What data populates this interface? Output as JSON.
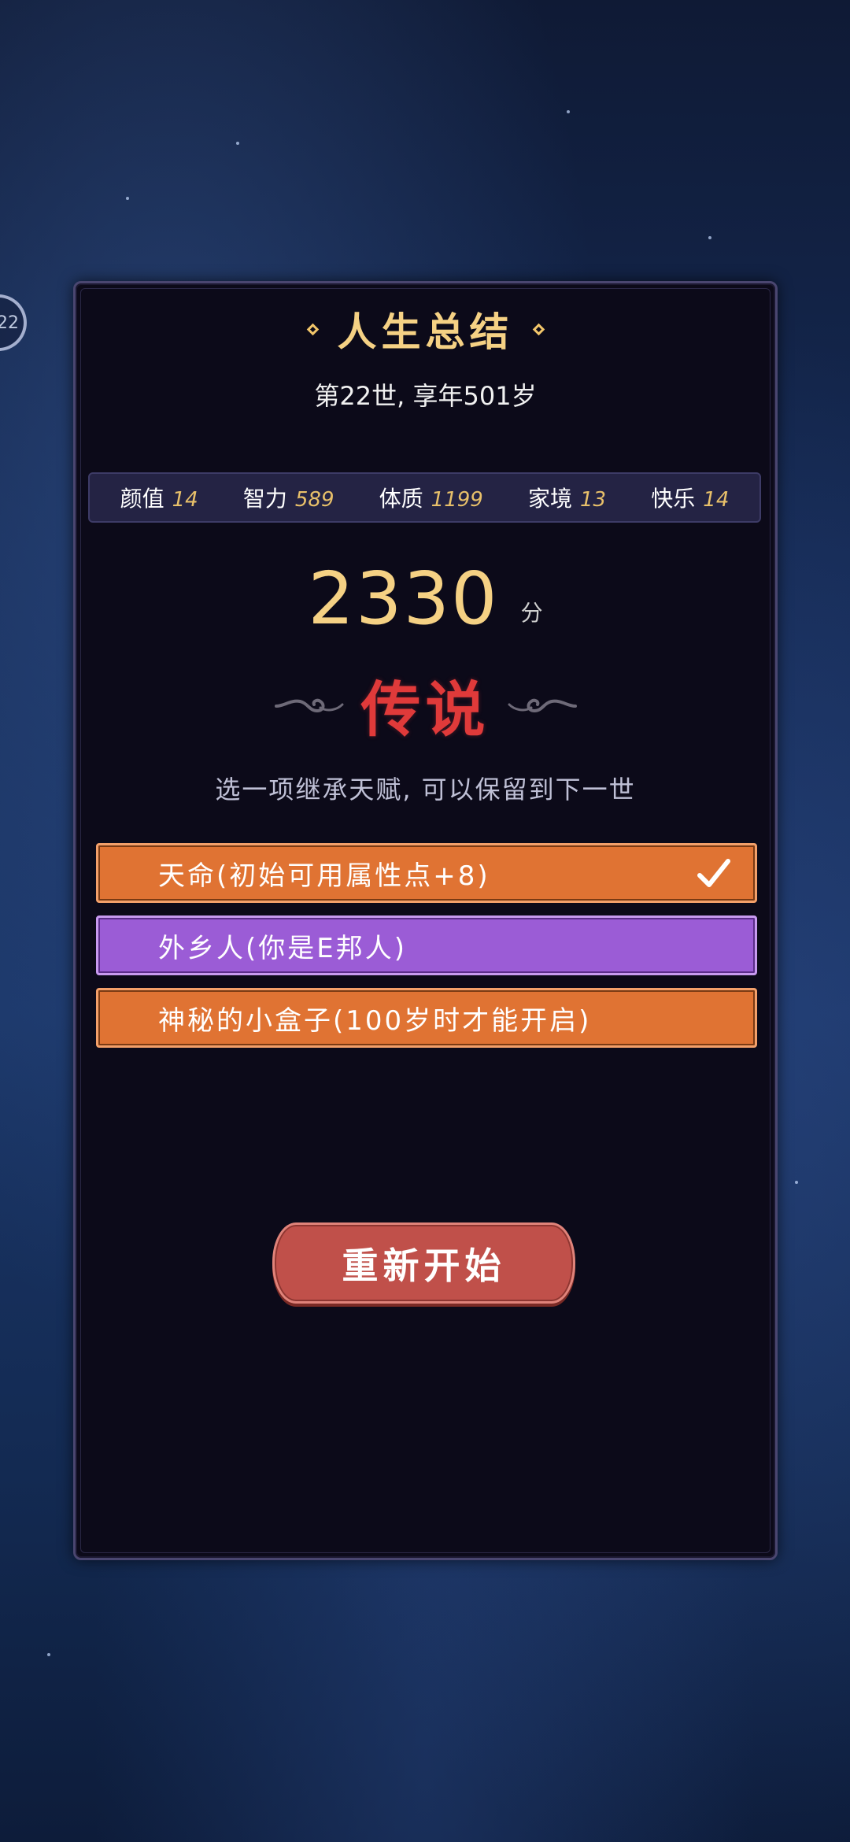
{
  "side_badge": {
    "text": "22"
  },
  "summary": {
    "title": "人生总结",
    "subtitle": "第22世, 享年501岁"
  },
  "stats": [
    {
      "label": "颜值",
      "value": "14"
    },
    {
      "label": "智力",
      "value": "589"
    },
    {
      "label": "体质",
      "value": "1199"
    },
    {
      "label": "家境",
      "value": "13"
    },
    {
      "label": "快乐",
      "value": "14"
    }
  ],
  "score": {
    "value": "2330",
    "unit": "分"
  },
  "grade": {
    "text": "传说",
    "color": "#e03a3a"
  },
  "hint": "选一项继承天赋, 可以保留到下一世",
  "talents": [
    {
      "label": "天命(初始可用属性点+8)",
      "selected": true,
      "color": "#e07333"
    },
    {
      "label": "外乡人(你是E邦人)",
      "selected": false,
      "color": "#9b5cd6"
    },
    {
      "label": "神秘的小盒子(100岁时才能开启)",
      "selected": false,
      "color": "#e07333"
    }
  ],
  "restart_button": {
    "label": "重新开始"
  }
}
